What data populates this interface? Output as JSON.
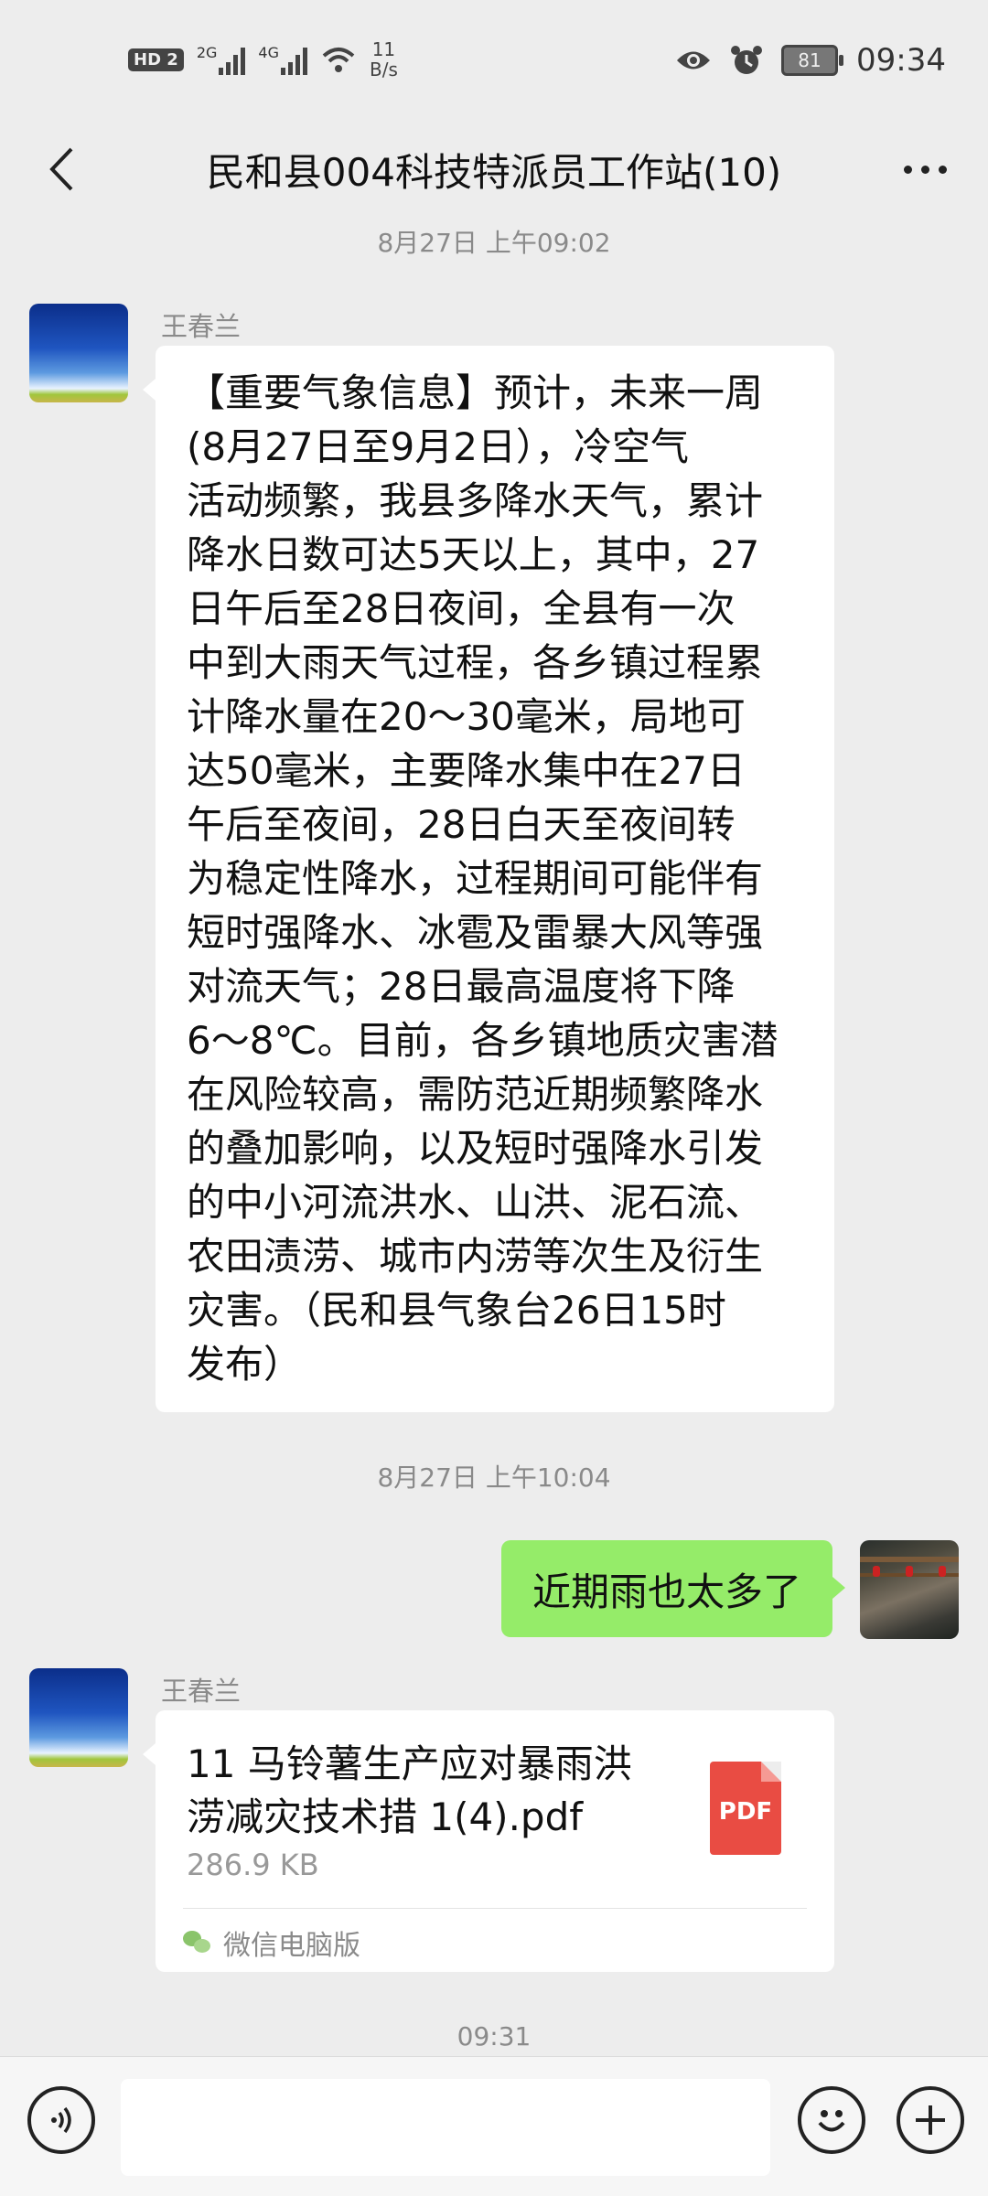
{
  "status_bar": {
    "badge_hd": "HD",
    "badge_2": "2",
    "net1": "2G",
    "net2": "4G",
    "speed_value": "11",
    "speed_unit": "B/s",
    "battery": "81",
    "time": "09:34"
  },
  "header": {
    "title": "民和县004科技特派员工作站(10)"
  },
  "messages": {
    "ts1": "8月27日 上午09:02",
    "msg1_sender": "王春兰",
    "msg1_text": "【重要气象信息】预计，未来一周\n(8月27日至9月2日），冷空气\n活动频繁，我县多降水天气，累计\n降水日数可达5天以上，其中，27\n日午后至28日夜间，全县有一次\n中到大雨天气过程，各乡镇过程累\n计降水量在20～30毫米，局地可\n达50毫米，主要降水集中在27日\n午后至夜间，28日白天至夜间转\n为稳定性降水，过程期间可能伴有\n短时强降水、冰雹及雷暴大风等强\n对流天气；28日最高温度将下降\n6～8℃。目前，各乡镇地质灾害潜\n在风险较高，需防范近期频繁降水\n的叠加影响，以及短时强降水引发\n的中小河流洪水、山洪、泥石流、\n农田渍涝、城市内涝等次生及衍生\n灾害。（民和县气象台26日15时\n发布）",
    "ts2": "8月27日 上午10:04",
    "msg2_text": "近期雨也太多了",
    "msg3_sender": "王春兰",
    "file_name": "11 马铃薯生产应对暴雨洪涝减灾技术措 1(4).pdf",
    "file_size": "286.9 KB",
    "file_type": "PDF",
    "file_source": "微信电脑版",
    "ts3": "09:31"
  },
  "input": {
    "value": "",
    "placeholder": ""
  },
  "icons": [
    "back-arrow-icon",
    "more-dots-icon",
    "voice-icon",
    "emoji-icon",
    "plus-icon",
    "pdf-file-icon",
    "wechat-icon",
    "eye-icon",
    "alarm-icon",
    "wifi-icon"
  ],
  "colors": {
    "background": "#ededed",
    "self_bubble": "#95ec69",
    "other_bubble": "#ffffff",
    "pdf": "#e94c43"
  }
}
